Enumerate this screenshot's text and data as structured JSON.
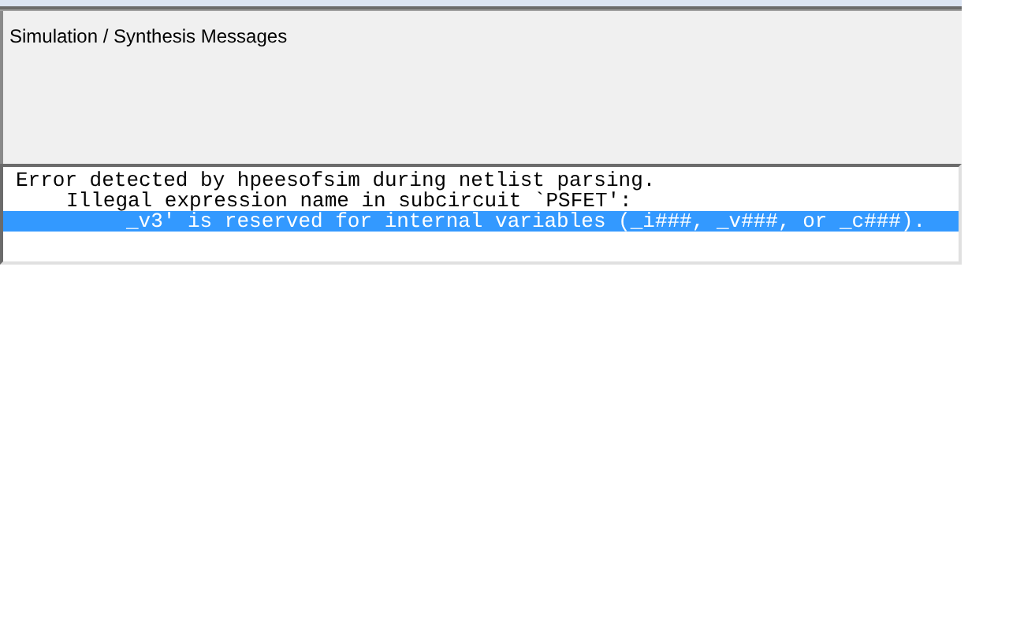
{
  "panel": {
    "title": "Simulation / Synthesis Messages"
  },
  "messages": [
    {
      "text": "Error detected by hpeesofsim during netlist parsing.",
      "kind": "error",
      "selected": false
    },
    {
      "text": "Illegal expression name in subcircuit `PSFET':",
      "kind": "detail",
      "selected": false
    },
    {
      "text": "_v3' is reserved for internal variables (_i###, _v###, or _c###).",
      "kind": "continuation",
      "selected": true
    }
  ]
}
